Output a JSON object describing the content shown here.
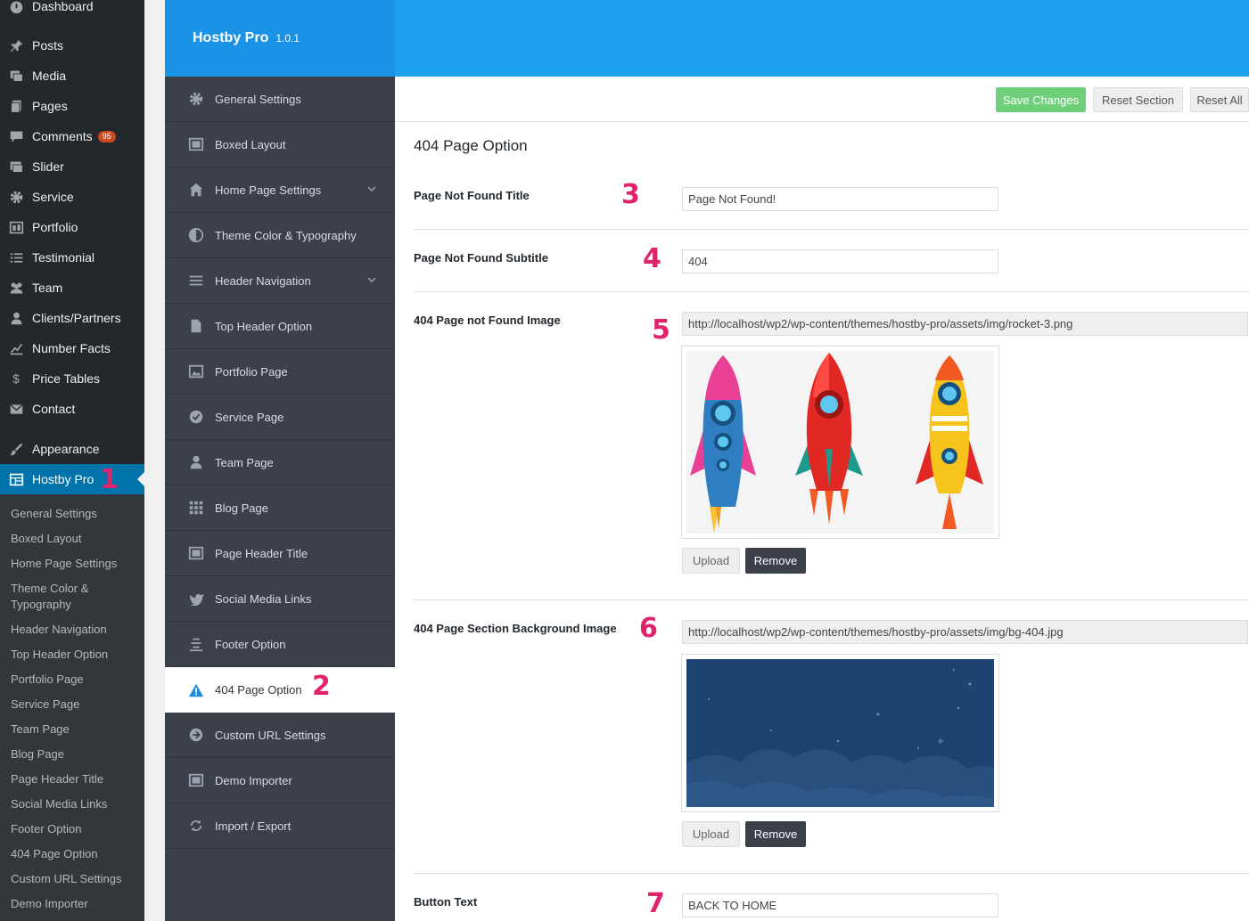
{
  "wp_menu": {
    "dashboard": "Dashboard",
    "posts": "Posts",
    "media": "Media",
    "pages": "Pages",
    "comments": "Comments",
    "comments_count": "95",
    "slider": "Slider",
    "service": "Service",
    "portfolio": "Portfolio",
    "testimonial": "Testimonial",
    "team": "Team",
    "clients": "Clients/Partners",
    "number_facts": "Number Facts",
    "price_tables": "Price Tables",
    "contact": "Contact",
    "appearance": "Appearance",
    "hostby": "Hostby Pro"
  },
  "wp_submenu": [
    "General Settings",
    "Boxed Layout",
    "Home Page Settings",
    "Theme Color & Typography",
    "Header Navigation",
    "Top Header Option",
    "Portfolio Page",
    "Service Page",
    "Team Page",
    "Blog Page",
    "Page Header Title",
    "Social Media Links",
    "Footer Option",
    "404 Page Option",
    "Custom URL Settings",
    "Demo Importer"
  ],
  "markers": [
    "1",
    "2",
    "3",
    "4",
    "5",
    "6",
    "7"
  ],
  "panel": {
    "brand": "Hostby Pro",
    "version": "1.0.1"
  },
  "options_menu": [
    "General Settings",
    "Boxed Layout",
    "Home Page Settings",
    "Theme Color & Typography",
    "Header Navigation",
    "Top Header Option",
    "Portfolio Page",
    "Service Page",
    "Team Page",
    "Blog Page",
    "Page Header Title",
    "Social Media Links",
    "Footer Option",
    "404 Page Option",
    "Custom URL Settings",
    "Demo Importer",
    "Import / Export"
  ],
  "toolbar": {
    "save": "Save Changes",
    "reset_section": "Reset Section",
    "reset_all": "Reset All"
  },
  "section": {
    "title": "404 Page Option",
    "fields": {
      "title_label": "Page Not Found Title",
      "title_value": "Page Not Found!",
      "subtitle_label": "Page Not Found Subtitle",
      "subtitle_value": "404",
      "image_label": "404 Page not Found Image",
      "image_url": "http://localhost/wp2/wp-content/themes/hostby-pro/assets/img/rocket-3.png",
      "bg_label": "404 Page Section Background Image",
      "bg_url": "http://localhost/wp2/wp-content/themes/hostby-pro/assets/img/bg-404.jpg",
      "button_label": "Button Text",
      "button_value": "BACK TO HOME"
    },
    "upload": "Upload",
    "remove": "Remove"
  },
  "colors": {
    "header_blue": "#1fa1ee",
    "wp_active": "#0073aa",
    "save_green": "#6fcf7b",
    "marker_pink": "#e0246c",
    "menu_dark": "#3b4049"
  }
}
